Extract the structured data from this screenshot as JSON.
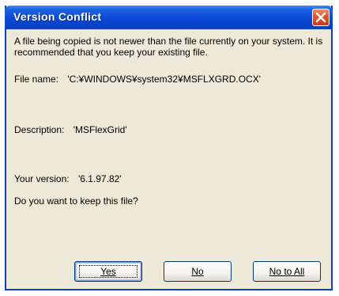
{
  "dialog": {
    "title": "Version Conflict",
    "message": "A file being copied is not newer than the file currently on your system. It is recommended that you keep your existing file.",
    "file_name_label": "File name:",
    "file_name_value": "'C:¥WINDOWS¥system32¥MSFLXGRD.OCX'",
    "description_label": "Description:",
    "description_value": "'MSFlexGrid'",
    "version_label": "Your version:",
    "version_value": "'6.1.97.82'",
    "question": "Do you want to keep this file?"
  },
  "buttons": {
    "yes": "Yes",
    "no": "No",
    "no_to_all": "No to All"
  },
  "colors": {
    "titlebar": "#0a4ad6",
    "close": "#e0542e",
    "dialog_bg": "#ece9d8"
  }
}
